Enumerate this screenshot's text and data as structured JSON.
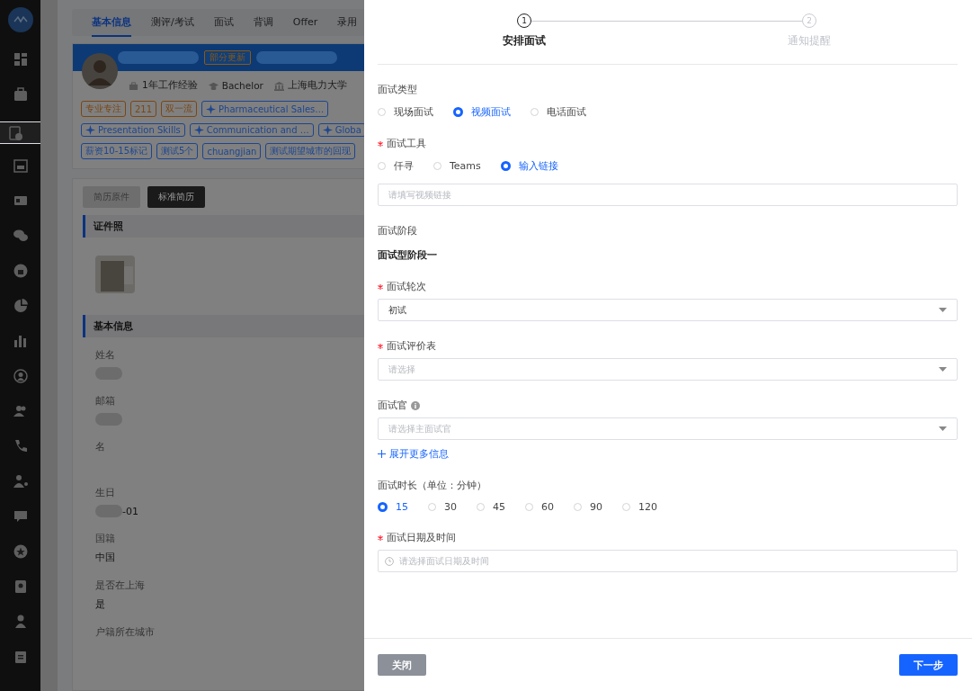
{
  "sidebar": {
    "items": [
      {
        "selected": false
      },
      {
        "selected": false
      },
      {
        "selected": true
      },
      {
        "selected": false
      },
      {
        "selected": false
      },
      {
        "selected": false
      },
      {
        "selected": false
      },
      {
        "selected": false
      },
      {
        "selected": false
      },
      {
        "selected": false
      },
      {
        "selected": false
      },
      {
        "selected": false
      },
      {
        "selected": false
      },
      {
        "selected": false
      },
      {
        "selected": false
      },
      {
        "selected": false
      },
      {
        "selected": false
      },
      {
        "selected": false
      }
    ]
  },
  "candidate": {
    "tabs": [
      {
        "label": "基本信息",
        "selected": true
      },
      {
        "label": "测评/考试",
        "selected": false
      },
      {
        "label": "面试",
        "selected": false
      },
      {
        "label": "背调",
        "selected": false
      },
      {
        "label": "Offer",
        "selected": false
      },
      {
        "label": "录用",
        "selected": false
      }
    ],
    "badge": "部分更新",
    "info": [
      {
        "kind": "experience",
        "text": "1年工作经验"
      },
      {
        "kind": "degree",
        "text": "Bachelor"
      },
      {
        "kind": "school",
        "text": "上海电力大学"
      }
    ],
    "tag_rows": [
      [
        {
          "kind": "label",
          "text": "专业专注",
          "color": "#7a4614"
        },
        {
          "kind": "label",
          "text": "211",
          "color": "#7a4614"
        },
        {
          "kind": "label",
          "text": "双一流",
          "color": "#7a4614"
        },
        {
          "kind": "skill",
          "text": "Pharmaceutical Sales…",
          "color": "#1c4590"
        }
      ],
      [
        {
          "kind": "skill",
          "text": "Presentation Skills",
          "color": "#1c4590"
        },
        {
          "kind": "skill",
          "text": "Communication and …",
          "color": "#1c4590"
        },
        {
          "kind": "skill",
          "text": "Globa",
          "color": "#1c4590"
        }
      ],
      [
        {
          "kind": "label",
          "text": "薪资10-15标记",
          "color": "#1c4590"
        },
        {
          "kind": "label",
          "text": "测试5个",
          "color": "#1c4590"
        },
        {
          "kind": "label",
          "text": "chuangjian",
          "color": "#1c4590"
        },
        {
          "kind": "label",
          "text": "测试期望城市的回现",
          "color": "#1c4590"
        }
      ]
    ],
    "resume_views": [
      {
        "label": "简历原件",
        "selected": false
      },
      {
        "label": "标准简历",
        "selected": true
      }
    ],
    "photo_section": "证件照",
    "info_section": "基本信息",
    "fields": [
      {
        "label": "姓名",
        "redacted": true
      },
      {
        "label": "邮箱",
        "redacted": true
      },
      {
        "label": "名",
        "redacted": false
      },
      {
        "label": "生日",
        "value": "-01",
        "redacted": true
      },
      {
        "label": "国籍",
        "value": "中国",
        "redacted": false
      },
      {
        "label": "是否在上海",
        "value": "是",
        "redacted": false
      },
      {
        "label": "户籍所在城市",
        "redacted": false
      }
    ]
  },
  "drawer": {
    "steps": [
      {
        "number": "1",
        "label": "安排面试",
        "selected": true
      },
      {
        "number": "2",
        "label": "通知提醒",
        "selected": false
      }
    ],
    "form": [
      {
        "kind": "radio",
        "label": "面试类型",
        "required": false,
        "options": [
          {
            "label": "现场面试",
            "selected": false
          },
          {
            "label": "视频面试",
            "selected": true
          },
          {
            "label": "电话面试",
            "selected": false
          }
        ]
      },
      {
        "kind": "radio",
        "label": "面试工具",
        "required": true,
        "options": [
          {
            "label": "仟寻",
            "selected": false
          },
          {
            "label": "Teams",
            "selected": false
          },
          {
            "label": "输入链接",
            "selected": true
          }
        ],
        "placeholder": "请填写视频链接"
      },
      {
        "kind": "static",
        "label": "面试阶段",
        "required": false,
        "value": "面试型阶段一"
      },
      {
        "kind": "select",
        "label": "面试轮次",
        "required": true,
        "value": "初试"
      },
      {
        "kind": "select",
        "label": "面试评价表",
        "required": true,
        "placeholder": "请选择"
      },
      {
        "kind": "select",
        "label": "面试官",
        "required": false,
        "info": true,
        "placeholder": "请选择主面试官",
        "link": "展开更多信息"
      },
      {
        "kind": "radio",
        "label": "面试时长（单位：分钟）",
        "required": false,
        "options": [
          {
            "label": "15",
            "selected": true
          },
          {
            "label": "30",
            "selected": false
          },
          {
            "label": "45",
            "selected": false
          },
          {
            "label": "60",
            "selected": false
          },
          {
            "label": "90",
            "selected": false
          },
          {
            "label": "120",
            "selected": false
          }
        ]
      },
      {
        "kind": "datetime",
        "label": "面试日期及时间",
        "required": true,
        "placeholder": "请选择面试日期及时间"
      }
    ],
    "buttons": [
      {
        "kind": "secondary",
        "label": "关闭"
      },
      {
        "kind": "primary",
        "label": "下一步"
      }
    ]
  }
}
